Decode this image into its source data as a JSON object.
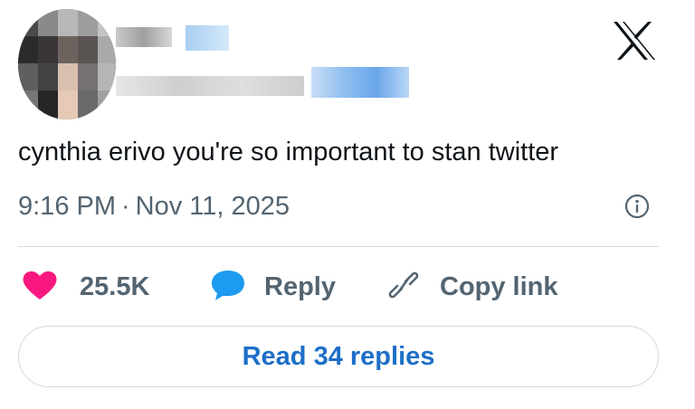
{
  "author": {
    "avatar_icon": "blurred-avatar",
    "name_hidden": true,
    "handle_hidden": true
  },
  "brand": {
    "logo_icon": "x-logo-icon"
  },
  "tweet": {
    "text": "cynthia erivo you're so important to stan twitter",
    "time": "9:16 PM",
    "separator": "·",
    "date": "Nov 11, 2025"
  },
  "actions": {
    "like": {
      "icon": "heart-icon",
      "label": "25.5K",
      "color": "#f91880"
    },
    "reply": {
      "icon": "speech-bubble-icon",
      "label": "Reply",
      "color": "#1d9bf0"
    },
    "copy_link": {
      "icon": "link-icon",
      "label": "Copy link"
    }
  },
  "read_replies": {
    "label": "Read 34 replies",
    "color": "#1d6fc8"
  },
  "colors": {
    "text": "#0f1419",
    "muted": "#536471",
    "divider": "#cfd9de"
  }
}
